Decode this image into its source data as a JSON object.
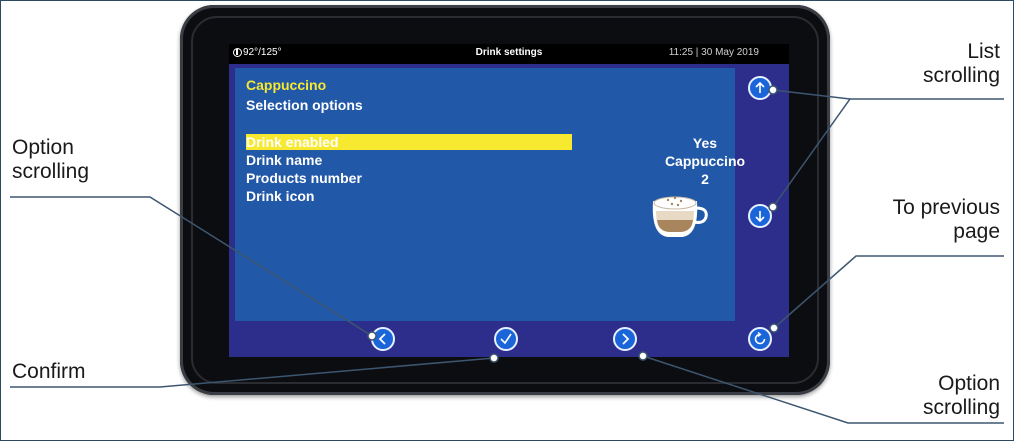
{
  "status_bar": {
    "temperature": "92°/125°",
    "title": "Drink settings",
    "datetime": "11:25 | 30 May 2019"
  },
  "drink": {
    "name": "Cappuccino",
    "section": "Selection options"
  },
  "options": [
    {
      "label": "Drink enabled",
      "value": "Yes",
      "selected": true
    },
    {
      "label": "Drink name",
      "value": "Cappuccino",
      "selected": false
    },
    {
      "label": "Products number",
      "value": "2",
      "selected": false
    },
    {
      "label": "Drink icon",
      "value": "",
      "selected": false
    }
  ],
  "icons": {
    "scroll_up": "arrow-up-icon",
    "scroll_down": "arrow-down-icon",
    "option_prev": "chevron-left-icon",
    "confirm": "check-icon",
    "option_next": "chevron-right-icon",
    "back": "refresh-back-icon",
    "drink_icon": "cappuccino-cup-icon",
    "temperature": "thermometer-icon"
  },
  "callouts": {
    "list_scrolling": "List\nscrolling",
    "option_scrolling_left": "Option\nscrolling",
    "to_previous_page": "To previous\npage",
    "confirm": "Confirm",
    "option_scrolling_right": "Option\nscrolling"
  },
  "colors": {
    "highlight": "#f7e830",
    "content_bg": "#2258a8",
    "frame_bg": "#2d2d8c",
    "button": "#1a66d8"
  }
}
